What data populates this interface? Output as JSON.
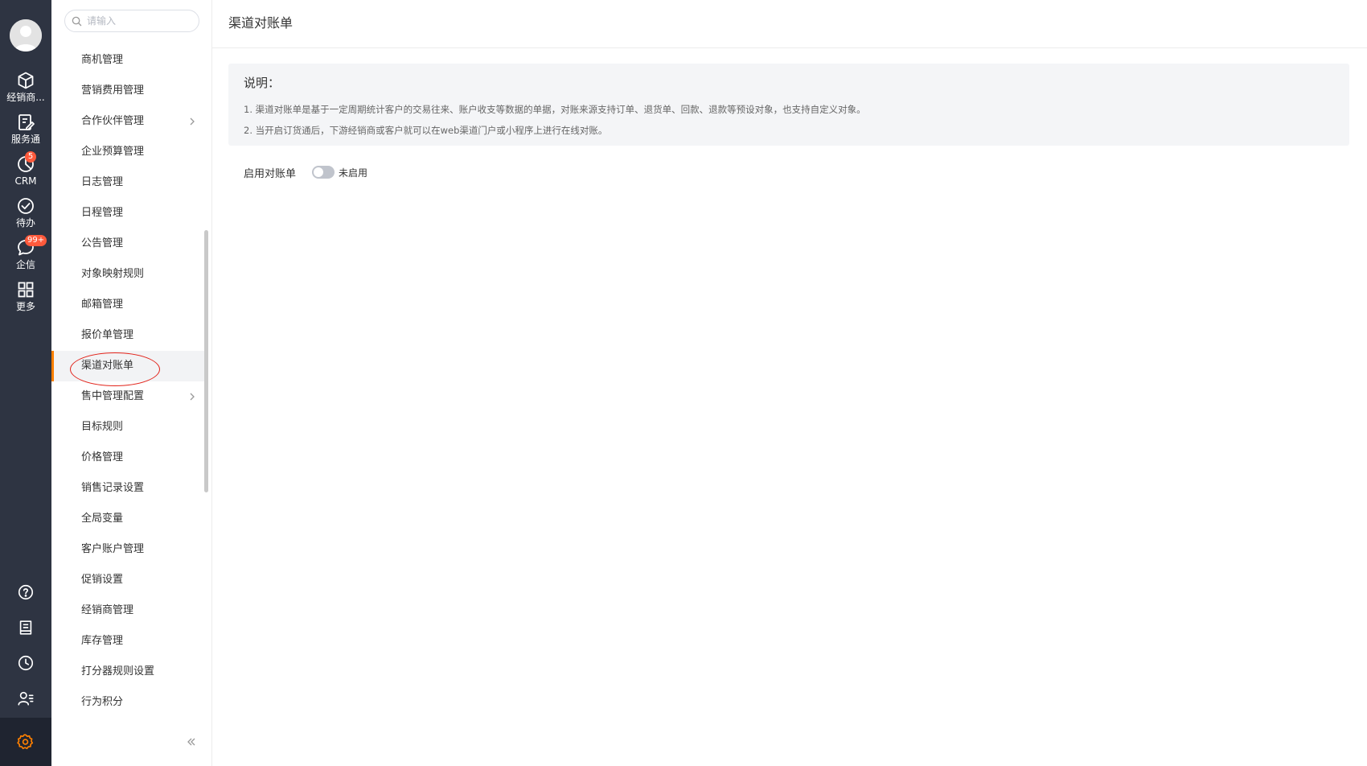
{
  "rail": {
    "items": [
      {
        "label": "经销商...",
        "icon": "cube-icon"
      },
      {
        "label": "服务通",
        "icon": "clipboard-edit-icon"
      },
      {
        "label": "CRM",
        "icon": "pie-chart-icon",
        "badge": "5"
      },
      {
        "label": "待办",
        "icon": "check-circle-icon"
      },
      {
        "label": "企信",
        "icon": "chat-bubble-icon",
        "badge": "99+"
      },
      {
        "label": "更多",
        "icon": "grid-icon"
      }
    ],
    "bottom_icons": [
      "help-icon",
      "notes-icon",
      "clock-icon",
      "contacts-icon",
      "settings-icon"
    ],
    "active_color": "#ff8000"
  },
  "menu": {
    "search_placeholder": "请输入",
    "items": [
      {
        "label": "商机管理"
      },
      {
        "label": "营销费用管理"
      },
      {
        "label": "合作伙伴管理",
        "has_children": true
      },
      {
        "label": "企业预算管理"
      },
      {
        "label": "日志管理"
      },
      {
        "label": "日程管理"
      },
      {
        "label": "公告管理"
      },
      {
        "label": "对象映射规则"
      },
      {
        "label": "邮箱管理"
      },
      {
        "label": "报价单管理"
      },
      {
        "label": "渠道对账单",
        "active": true
      },
      {
        "label": "售中管理配置",
        "has_children": true
      },
      {
        "label": "目标规则"
      },
      {
        "label": "价格管理"
      },
      {
        "label": "销售记录设置"
      },
      {
        "label": "全局变量"
      },
      {
        "label": "客户账户管理"
      },
      {
        "label": "促销设置"
      },
      {
        "label": "经销商管理"
      },
      {
        "label": "库存管理"
      },
      {
        "label": "打分器规则设置"
      },
      {
        "label": "行为积分"
      }
    ]
  },
  "main": {
    "title": "渠道对账单",
    "notice": {
      "title": "说明：",
      "lines": [
        "1. 渠道对账单是基于一定周期统计客户的交易往来、账户收支等数据的单据，对账来源支持订单、退货单、回款、退款等预设对象，也支持自定义对象。",
        "2. 当开启订货通后，下游经销商或客户就可以在web渠道门户或小程序上进行在线对账。"
      ]
    },
    "enable_label": "启用对账单",
    "switch_status": "未启用"
  }
}
